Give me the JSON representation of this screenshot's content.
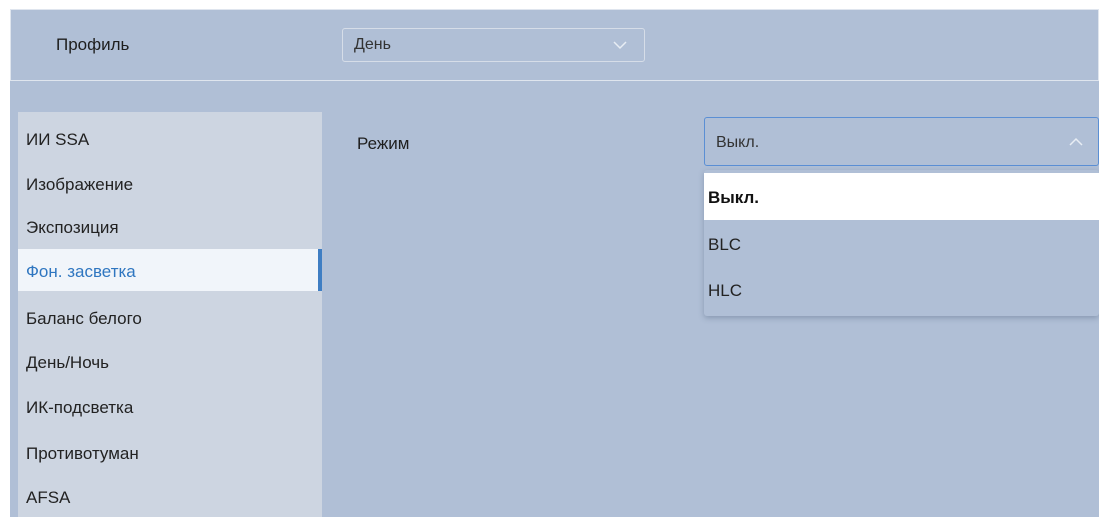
{
  "profile": {
    "label": "Профиль",
    "select_value": "День"
  },
  "sidebar": {
    "items": [
      {
        "label": "ИИ SSA",
        "active": false
      },
      {
        "label": "Изображение",
        "active": false
      },
      {
        "label": "Экспозиция",
        "active": false
      },
      {
        "label": "Фон. засветка",
        "active": true
      },
      {
        "label": "Баланс белого",
        "active": false
      },
      {
        "label": "День/Ночь",
        "active": false
      },
      {
        "label": "ИК-подсветка",
        "active": false
      },
      {
        "label": "Противотуман",
        "active": false
      },
      {
        "label": "AFSA",
        "active": false
      }
    ]
  },
  "mode": {
    "label": "Режим",
    "select_value": "Выкл.",
    "options": [
      "Выкл.",
      "BLC",
      "HLC"
    ],
    "selected_index": 0
  },
  "icons": {
    "profile_chevron": "chevron-down-icon",
    "mode_chevron": "chevron-up-icon"
  },
  "colors": {
    "panel_background": "#b0bfd6",
    "sidebar_background": "#cdd5e1",
    "active_item_background": "#f1f5fa",
    "accent": "#3f7ec3",
    "focused_border": "#5b8fd4"
  }
}
